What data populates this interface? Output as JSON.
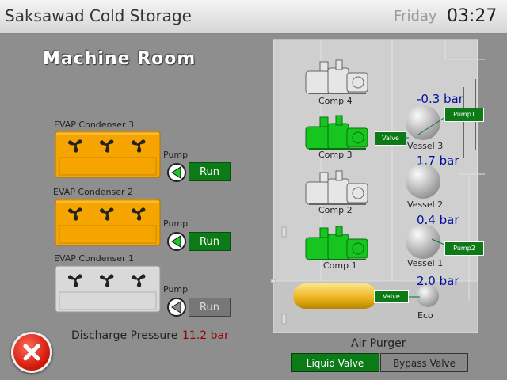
{
  "header": {
    "title": "Saksawad Cold Storage",
    "day": "Friday",
    "time": "03:27"
  },
  "room_title": "Machine Room",
  "condensers": [
    {
      "label": "EVAP Condenser 3",
      "pump_label": "Pump",
      "status": "Run",
      "active": true
    },
    {
      "label": "EVAP Condenser 2",
      "pump_label": "Pump",
      "status": "Run",
      "active": true
    },
    {
      "label": "EVAP Condenser 1",
      "pump_label": "Pump",
      "status": "Run",
      "active": false
    }
  ],
  "compressors": [
    {
      "label": "Comp 4",
      "active": false
    },
    {
      "label": "Comp 3",
      "active": true
    },
    {
      "label": "Comp 2",
      "active": false
    },
    {
      "label": "Comp 1",
      "active": true
    }
  ],
  "vessels": [
    {
      "label": "Vessel 3",
      "pressure": "-0.3 bar"
    },
    {
      "label": "Vessel 2",
      "pressure": "1.7 bar"
    },
    {
      "label": "Vessel 1",
      "pressure": "0.4 bar"
    },
    {
      "label": "Eco",
      "pressure": "2.0 bar"
    }
  ],
  "callouts": {
    "pump1": "Pump1",
    "pump2": "Pump2",
    "valve_top": "Valve",
    "valve_bottom": "Valve"
  },
  "discharge": {
    "label": "Discharge Pressure",
    "value": "11.2 bar"
  },
  "air_purger": {
    "title": "Air Purger",
    "liquid_valve": "Liquid Valve",
    "bypass_valve": "Bypass Valve"
  },
  "colors": {
    "active": "#0b7a17",
    "condenser_active": "#f5a400",
    "condenser_idle": "#d9d9d9",
    "pressure_text": "#00109a"
  }
}
